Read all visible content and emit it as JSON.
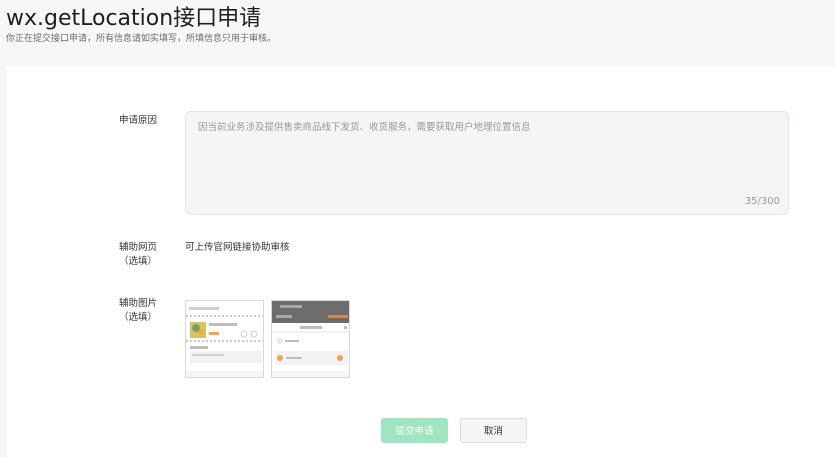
{
  "header": {
    "title": "wx.getLocation接口申请",
    "subtitle": "你正在提交接口申请，所有信息请如实填写，所填信息只用于审核。"
  },
  "form": {
    "reason": {
      "label": "申请原因",
      "placeholder": "因当前业务涉及提供售卖商品线下发货、收货服务，需要获取用户地理位置信息",
      "counter": "35/300"
    },
    "webpage": {
      "label_line1": "辅助网页",
      "label_line2": "（选填）",
      "hint": "可上传官网链接协助审核"
    },
    "images": {
      "label_line1": "辅助图片",
      "label_line2": "（选填）"
    }
  },
  "actions": {
    "submit_label": "提交申请",
    "cancel_label": "取消"
  },
  "colors": {
    "primary_disabled": "#9fe5c1",
    "accent_orange": "#f5a34a"
  }
}
